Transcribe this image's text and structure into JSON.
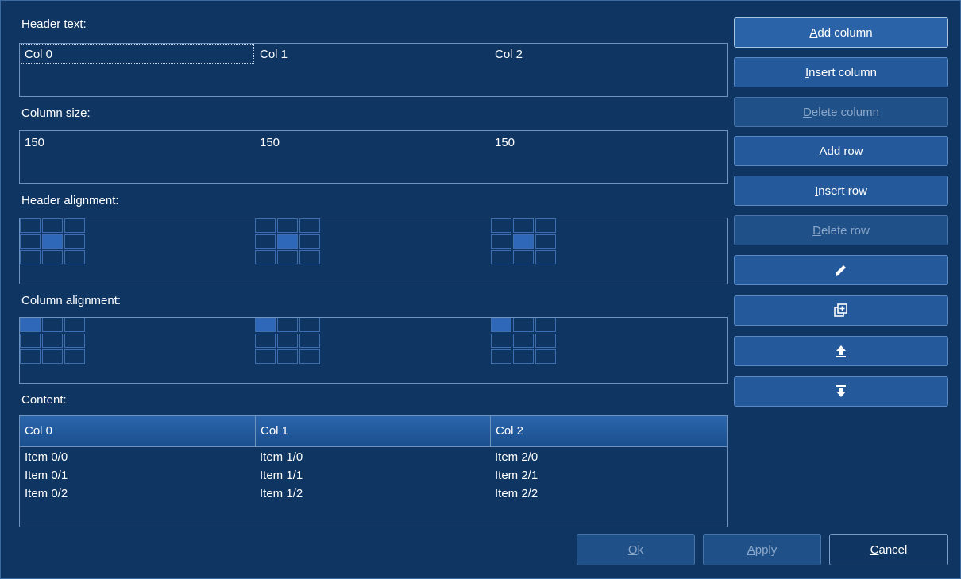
{
  "labels": {
    "header_text": "Header text:",
    "column_size": "Column size:",
    "header_alignment": "Header alignment:",
    "column_alignment": "Column alignment:",
    "content": "Content:"
  },
  "header_text_values": [
    "Col 0",
    "Col 1",
    "Col 2"
  ],
  "column_size_values": [
    "150",
    "150",
    "150"
  ],
  "header_alignment": [
    "middle-center",
    "middle-center",
    "middle-center"
  ],
  "column_alignment": [
    "top-left",
    "top-left",
    "top-left"
  ],
  "content_table": {
    "columns": [
      "Col 0",
      "Col 1",
      "Col 2"
    ],
    "rows": [
      [
        "Item 0/0",
        "Item 1/0",
        "Item 2/0"
      ],
      [
        "Item 0/1",
        "Item 1/1",
        "Item 2/1"
      ],
      [
        "Item 0/2",
        "Item 1/2",
        "Item 2/2"
      ]
    ]
  },
  "side_buttons": {
    "add_column": {
      "mn": "A",
      "rest": "dd column",
      "enabled": true
    },
    "insert_column": {
      "mn": "I",
      "rest": "nsert column",
      "enabled": true
    },
    "delete_column": {
      "mn": "D",
      "rest": "elete column",
      "enabled": false
    },
    "add_row": {
      "mn": "A",
      "rest": "dd row",
      "enabled": true
    },
    "insert_row": {
      "mn": "I",
      "rest": "nsert row",
      "enabled": true
    },
    "delete_row": {
      "mn": "D",
      "rest": "elete row",
      "enabled": false
    },
    "edit_icon": "pencil-icon",
    "duplicate_icon": "duplicate-icon",
    "move_up_icon": "move-up-icon",
    "move_down_icon": "move-down-icon"
  },
  "dialog_buttons": {
    "ok": {
      "mn": "O",
      "rest": "k",
      "enabled": false
    },
    "apply": {
      "mn": "A",
      "rest": "pply",
      "enabled": false
    },
    "cancel": {
      "mn": "C",
      "rest": "ancel",
      "enabled": true
    }
  },
  "colors": {
    "background": "#0f3562",
    "button": "#245a9b",
    "selected_cell": "#2f68b8",
    "border": "#6f93bd"
  }
}
